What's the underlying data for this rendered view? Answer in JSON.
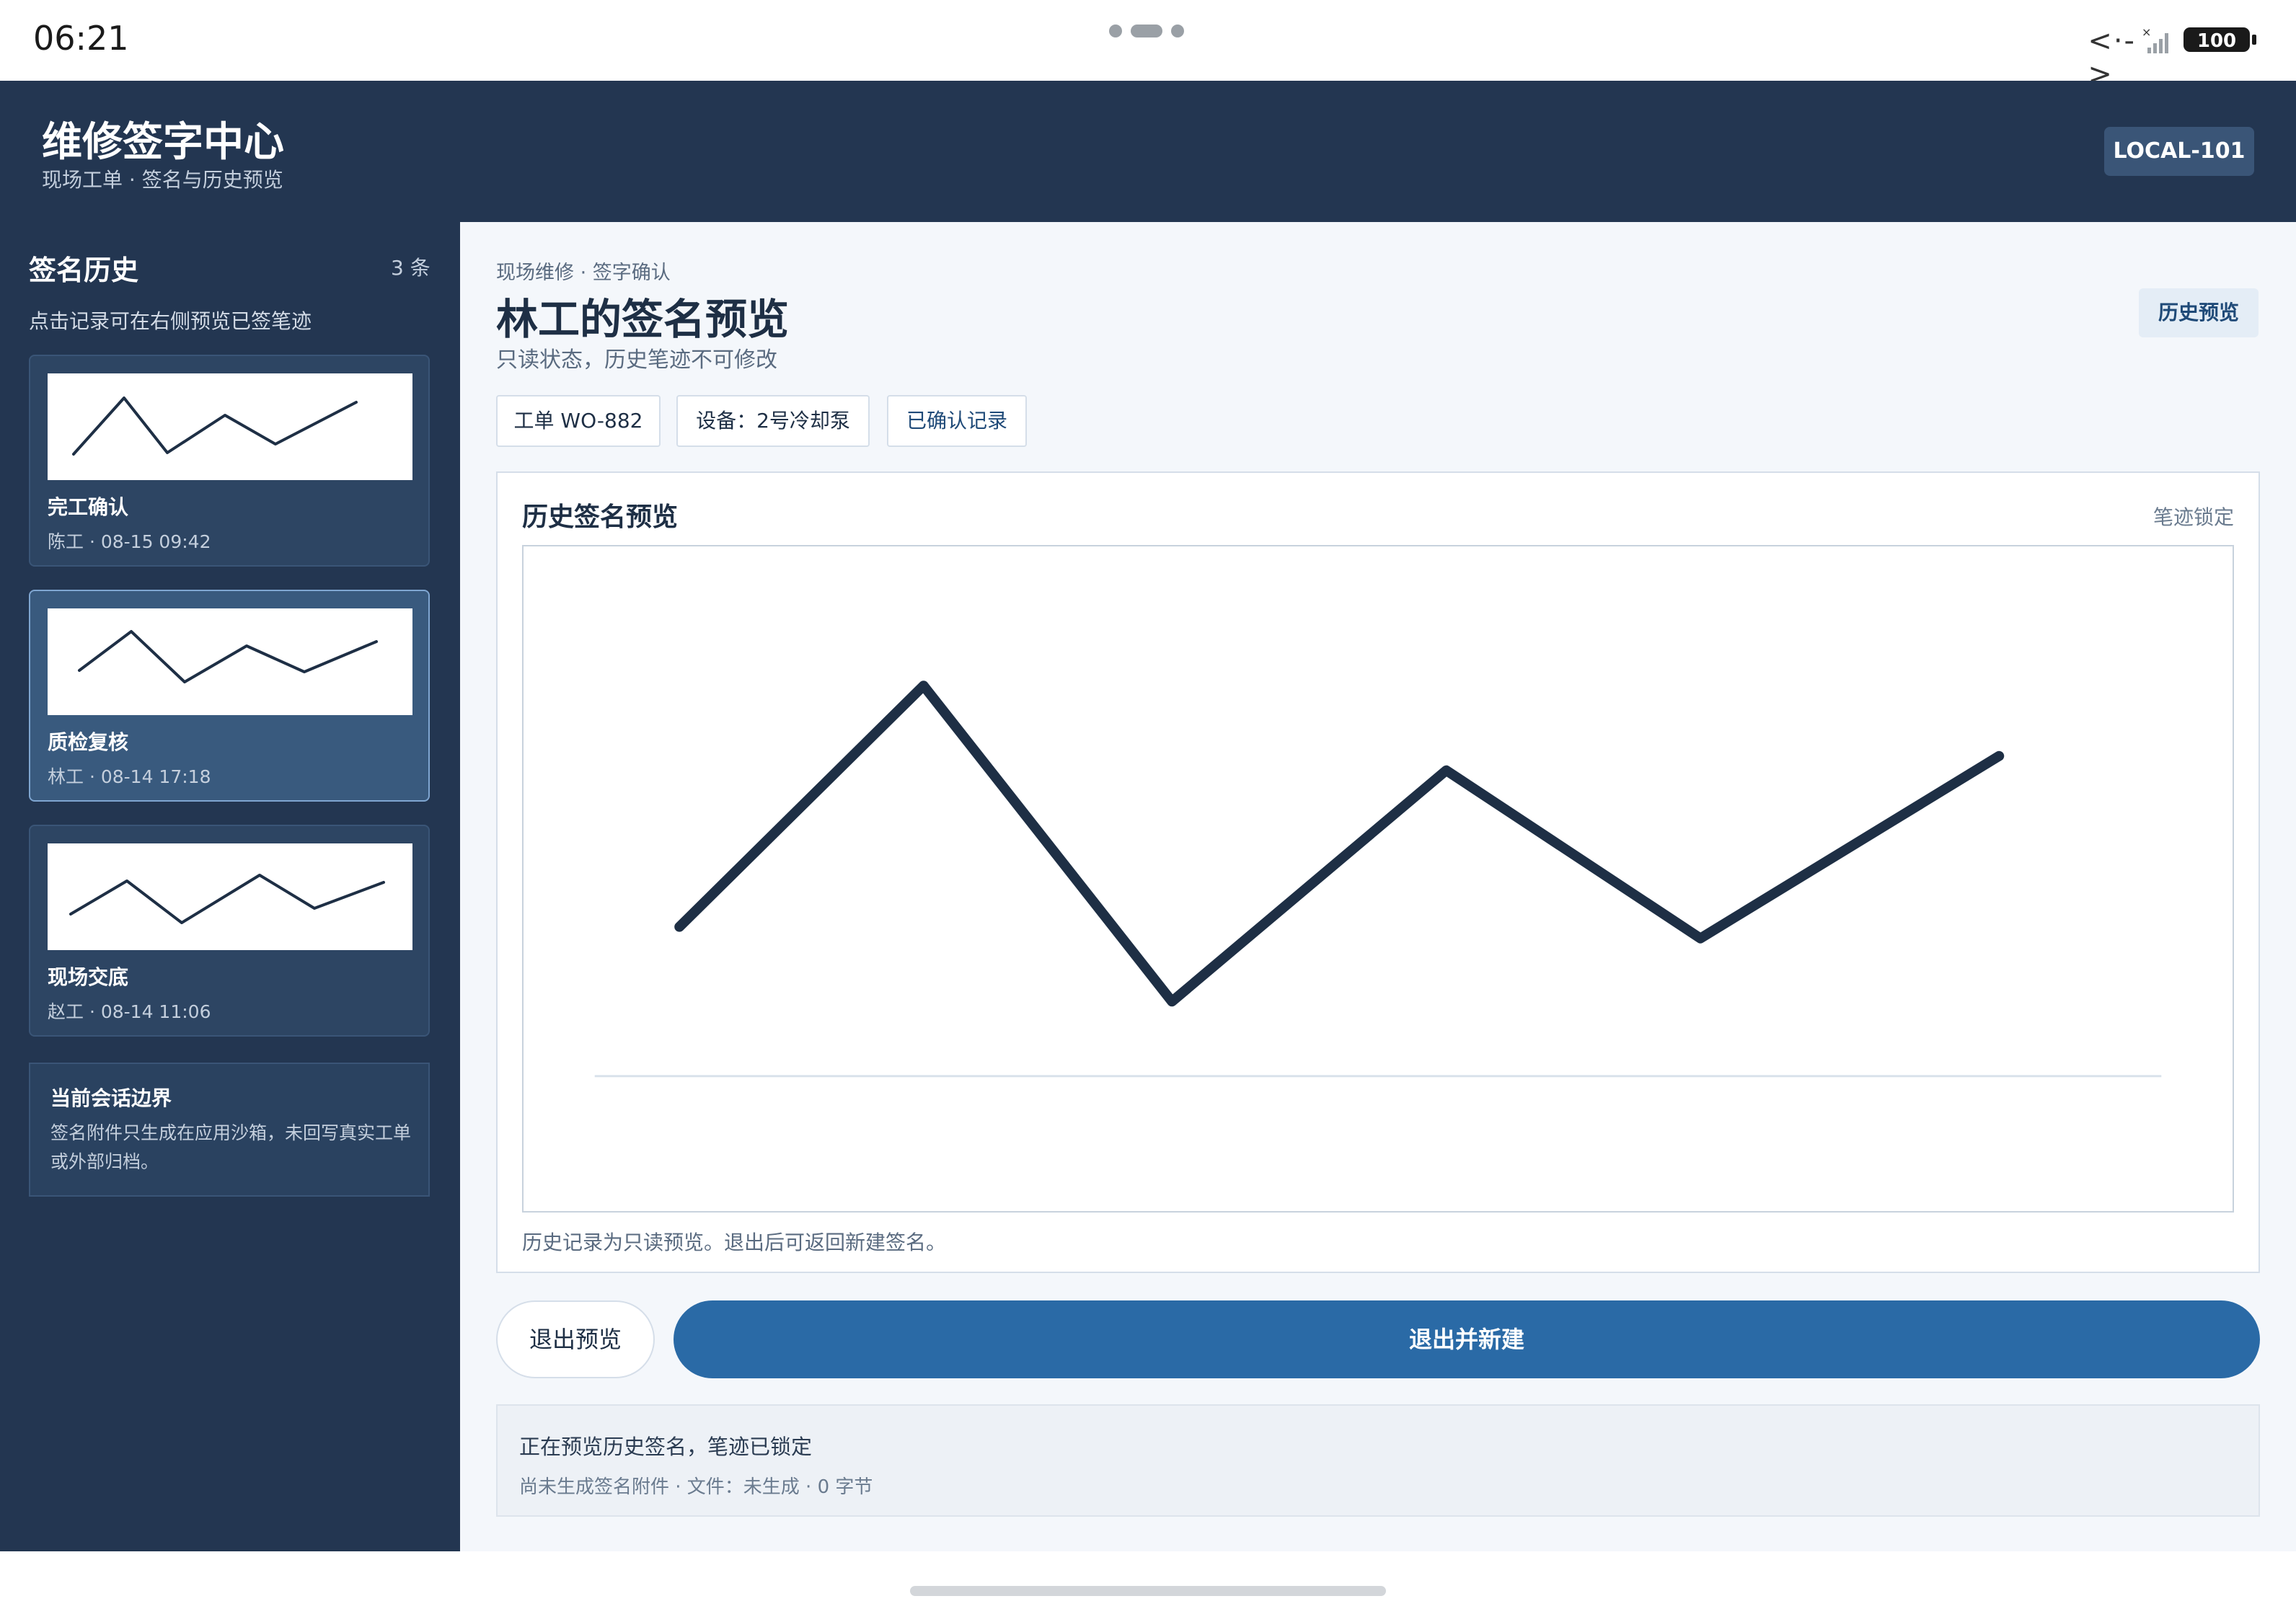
{
  "status_bar": {
    "time": "06:21",
    "code_glyph": "<·->",
    "x_mark": "×",
    "battery": "100"
  },
  "header": {
    "title": "维修签字中心",
    "subtitle": "现场工单 · 签名与历史预览",
    "device": "LOCAL-101"
  },
  "sidebar": {
    "title": "签名历史",
    "count": "3 条",
    "hint": "点击记录可在右侧预览已签笔迹",
    "records": [
      {
        "title": "完工确认",
        "meta": "陈工 · 08-15 09:42"
      },
      {
        "title": "质检复核",
        "meta": "林工 · 08-14 17:18"
      },
      {
        "title": "现场交底",
        "meta": "赵工 · 08-14 11:06"
      }
    ],
    "boundary": {
      "title": "当前会话边界",
      "text": "签名附件只生成在应用沙箱，未回写真实工单或外部归档。"
    }
  },
  "main": {
    "breadcrumb": "现场维修 · 签字确认",
    "title": "林工的签名预览",
    "subtitle": "只读状态，历史笔迹不可修改",
    "tag": "历史预览",
    "chips": [
      "工单 WO-882",
      "设备：2号冷却泵",
      "已确认记录"
    ],
    "panel": {
      "title": "历史签名预览",
      "lock": "笔迹锁定",
      "note": "历史记录为只读预览。退出后可返回新建签名。"
    },
    "buttons": {
      "exit": "退出预览",
      "exit_new": "退出并新建"
    },
    "status": {
      "main": "正在预览历史签名，笔迹已锁定",
      "sub": "尚未生成签名附件 · 文件：未生成 · 0 字节"
    }
  },
  "colors": {
    "header_bg": "#233651",
    "accent": "#2a6aa6",
    "stroke": "#1e2f45"
  }
}
